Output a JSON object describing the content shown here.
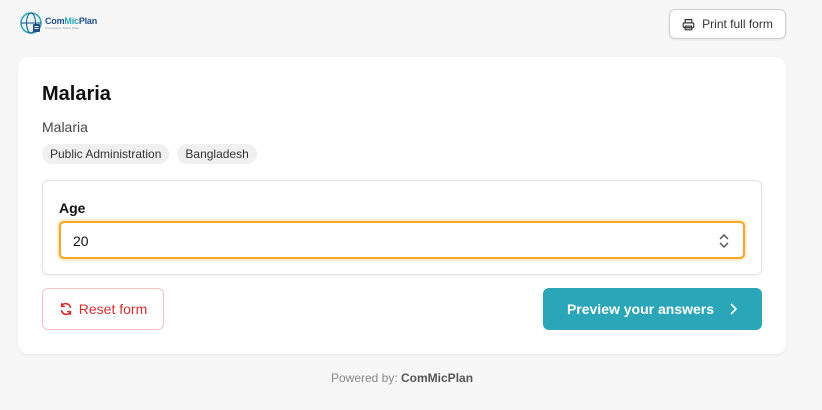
{
  "header": {
    "logo": {
      "name_part1": "Com",
      "name_part2": "Mic",
      "name_part3": "Plan",
      "tagline": "Community Micro Plan"
    },
    "print_label": "Print full form"
  },
  "form": {
    "title": "Malaria",
    "subtitle": "Malaria",
    "tags": [
      "Public Administration",
      "Bangladesh"
    ],
    "question": {
      "label": "Age",
      "value": "20"
    },
    "reset_label": "Reset form",
    "preview_label": "Preview your answers"
  },
  "footer": {
    "prefix": "Powered by:",
    "brand": "ComMicPlan"
  },
  "colors": {
    "accent": "#2aa6b8",
    "focus": "#f5a623",
    "danger": "#d32f2f"
  }
}
